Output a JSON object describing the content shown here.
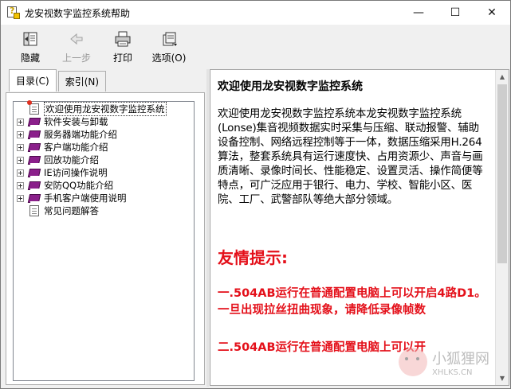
{
  "window": {
    "title": "龙安视数字监控系统帮助"
  },
  "controls": {
    "minimize": "—",
    "maximize": "☐",
    "close": "✕"
  },
  "toolbar": {
    "buttons": [
      {
        "label": "隐藏",
        "icon": "hide-icon",
        "enabled": true
      },
      {
        "label": "上一步",
        "icon": "back-arrow-icon",
        "enabled": false
      },
      {
        "label": "打印",
        "icon": "printer-icon",
        "enabled": true
      },
      {
        "label": "选项(O)",
        "icon": "options-icon",
        "enabled": true
      }
    ]
  },
  "tabs": [
    {
      "label": "目录(C)",
      "active": true
    },
    {
      "label": "索引(N)",
      "active": false
    }
  ],
  "tree": {
    "items": [
      {
        "label": "欢迎使用龙安视数字监控系统",
        "type": "page",
        "expandable": false,
        "selected": true
      },
      {
        "label": "软件安装与卸载",
        "type": "book",
        "expandable": true
      },
      {
        "label": "服务器端功能介绍",
        "type": "book",
        "expandable": true
      },
      {
        "label": "客户端功能介绍",
        "type": "book",
        "expandable": true
      },
      {
        "label": "回放功能介绍",
        "type": "book",
        "expandable": true
      },
      {
        "label": "IE访问操作说明",
        "type": "book",
        "expandable": true
      },
      {
        "label": "安防QQ功能介绍",
        "type": "book",
        "expandable": true
      },
      {
        "label": "手机客户端使用说明",
        "type": "book",
        "expandable": true
      },
      {
        "label": "常见问题解答",
        "type": "page",
        "expandable": false
      }
    ]
  },
  "content": {
    "title": "欢迎使用龙安视数字监控系统",
    "body": "欢迎使用龙安视数字监控系统本龙安视数字监控系统(Lonse)集音视频数据实时采集与压缩、联动报警、辅助设备控制、网络远程控制等于一体，数据压缩采用H.264算法，整套系统具有运行速度快、占用资源少、声音与画质清晰、录像时间长、性能稳定、设置灵活、操作简便等特点，可广泛应用于银行、电力、学校、智能小区、医院、工厂、武警部队等绝大部分领域。",
    "tip_heading": "友情提示:",
    "tip_1": "一.504AB运行在普通配置电脑上可以开启4路D1。一旦出现拉丝扭曲现象，请降低录像帧数",
    "tip_2": "二.504AB运行在普通配置电脑上可以开"
  },
  "watermark": {
    "cn": "小狐狸网",
    "en": "XHLKS.CN"
  },
  "colors": {
    "tip_red": "#e4101a",
    "book_purple": "#8a1f8a"
  }
}
